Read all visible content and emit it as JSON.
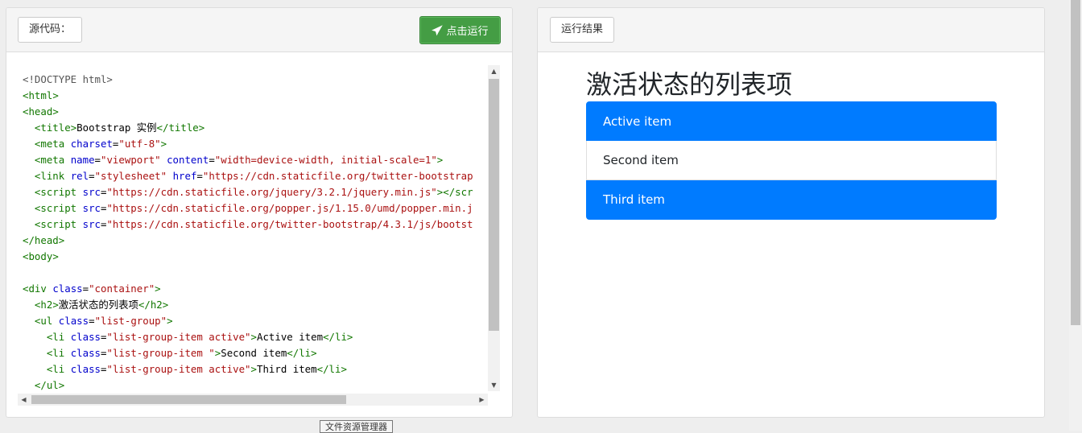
{
  "left_panel": {
    "source_button": "源代码：",
    "run_button": "点击运行",
    "run_icon": "paper-plane-icon"
  },
  "right_panel": {
    "result_button": "运行结果",
    "heading": "激活状态的列表项",
    "list_items": [
      {
        "label": "Active item",
        "active": true
      },
      {
        "label": "Second item",
        "active": false
      },
      {
        "label": "Third item",
        "active": true
      }
    ]
  },
  "code_lines": [
    "<!DOCTYPE html>",
    "<html>",
    "<head>",
    "  <title>Bootstrap 实例</title>",
    "  <meta charset=\"utf-8\">",
    "  <meta name=\"viewport\" content=\"width=device-width, initial-scale=1\">",
    "  <link rel=\"stylesheet\" href=\"https://cdn.staticfile.org/twitter-bootstrap",
    "  <script src=\"https://cdn.staticfile.org/jquery/3.2.1/jquery.min.js\"></scr",
    "  <script src=\"https://cdn.staticfile.org/popper.js/1.15.0/umd/popper.min.j",
    "  <script src=\"https://cdn.staticfile.org/twitter-bootstrap/4.3.1/js/bootst",
    "</head>",
    "<body>",
    "",
    "<div class=\"container\">",
    "  <h2>激活状态的列表项</h2>",
    "  <ul class=\"list-group\">",
    "    <li class=\"list-group-item active\">Active item</li>",
    "    <li class=\"list-group-item \">Second item</li>",
    "    <li class=\"list-group-item active\">Third item</li>",
    "  </ul>"
  ],
  "tooltip": "文件资源管理器",
  "colors": {
    "tag": "#117700",
    "attribute": "#0000cc",
    "string": "#aa1111",
    "active_item": "#007bff",
    "run_button": "#449d44"
  }
}
